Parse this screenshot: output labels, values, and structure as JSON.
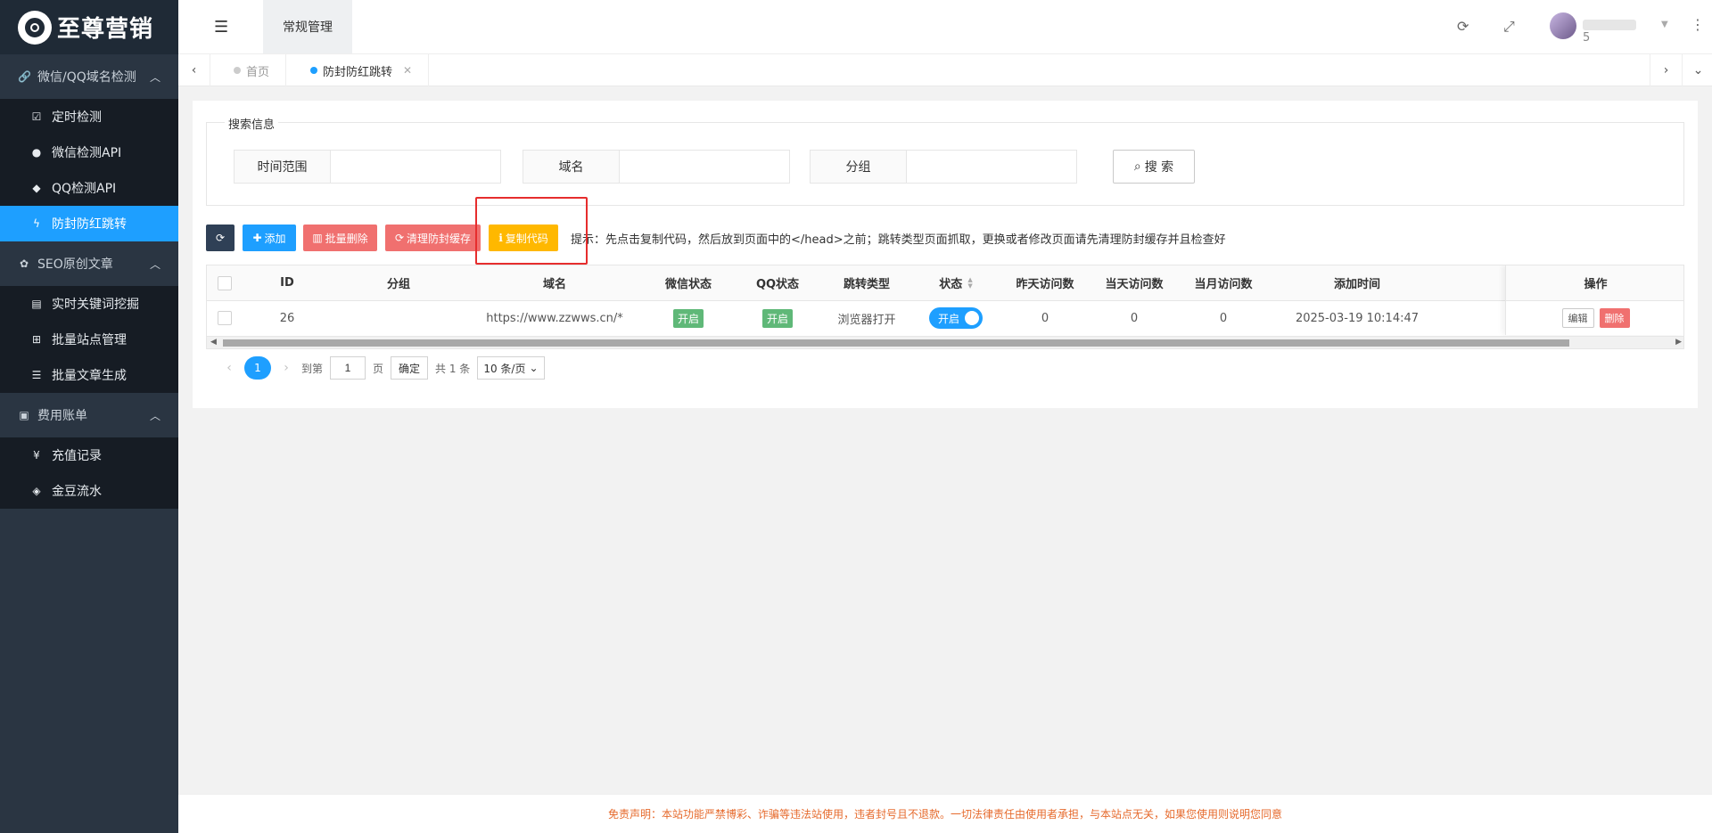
{
  "app": {
    "logo_text": "至尊营销"
  },
  "sidebar": {
    "groups": [
      {
        "label": "微信/QQ域名检测",
        "icon": "link-icon",
        "items": [
          {
            "label": "定时检测",
            "icon": "checkbox-icon"
          },
          {
            "label": "微信检测API",
            "icon": "wechat-icon"
          },
          {
            "label": "QQ检测API",
            "icon": "qq-icon"
          },
          {
            "label": "防封防红跳转",
            "icon": "bolt-icon",
            "active": true
          }
        ]
      },
      {
        "label": "SEO原创文章",
        "icon": "paw-icon",
        "items": [
          {
            "label": "实时关键词挖掘",
            "icon": "book-icon"
          },
          {
            "label": "批量站点管理",
            "icon": "sitemap-icon"
          },
          {
            "label": "批量文章生成",
            "icon": "list-icon"
          }
        ]
      },
      {
        "label": "费用账单",
        "icon": "bill-icon",
        "items": [
          {
            "label": "充值记录",
            "icon": "yen-icon"
          },
          {
            "label": "金豆流水",
            "icon": "drop-icon"
          }
        ]
      }
    ]
  },
  "header": {
    "tab": "常规管理",
    "username_suffix": "5"
  },
  "tabs": [
    {
      "label": "首页"
    },
    {
      "label": "防封防红跳转",
      "active": true
    }
  ],
  "search": {
    "legend": "搜索信息",
    "fields": [
      {
        "label": "时间范围",
        "value": ""
      },
      {
        "label": "域名",
        "value": ""
      },
      {
        "label": "分组",
        "value": ""
      }
    ],
    "button": "搜 索"
  },
  "toolbar": {
    "add": "添加",
    "batch_delete": "批量删除",
    "clear_cache": "清理防封缓存",
    "copy_code": "复制代码",
    "tip": "提示：先点击复制代码，然后放到页面中的</head>之前；跳转类型页面抓取，更换或者修改页面请先清理防封缓存并且检查好"
  },
  "table": {
    "headers": [
      "ID",
      "分组",
      "域名",
      "微信状态",
      "QQ状态",
      "跳转类型",
      "状态",
      "昨天访问数",
      "当天访问数",
      "当月访问数",
      "添加时间",
      "操作"
    ],
    "rows": [
      {
        "id": "26",
        "group": "",
        "domain": "https://www.zzwws.cn/*",
        "wechat_status": "开启",
        "qq_status": "开启",
        "jump_type": "浏览器打开",
        "status": "开启",
        "yesterday": "0",
        "today": "0",
        "month": "0",
        "added": "2025-03-19 10:14:47",
        "edit": "编辑",
        "delete": "删除"
      }
    ]
  },
  "pager": {
    "current": "1",
    "goto_label": "到第",
    "goto_value": "1",
    "page_label": "页",
    "ok": "确定",
    "total": "共 1 条",
    "per_page": "10 条/页"
  },
  "footer": {
    "disclaimer": "免责声明：本站功能严禁博彩、诈骗等违法站使用，违者封号且不退款。一切法律责任由使用者承担，与本站点无关，如果您使用则说明您同意"
  },
  "colors": {
    "accent": "#1e9fff",
    "sidebar": "#2a3542",
    "warning": "#ffb800",
    "danger": "#f0706f",
    "success": "#5fb878",
    "highlight": "#e62d2d"
  }
}
